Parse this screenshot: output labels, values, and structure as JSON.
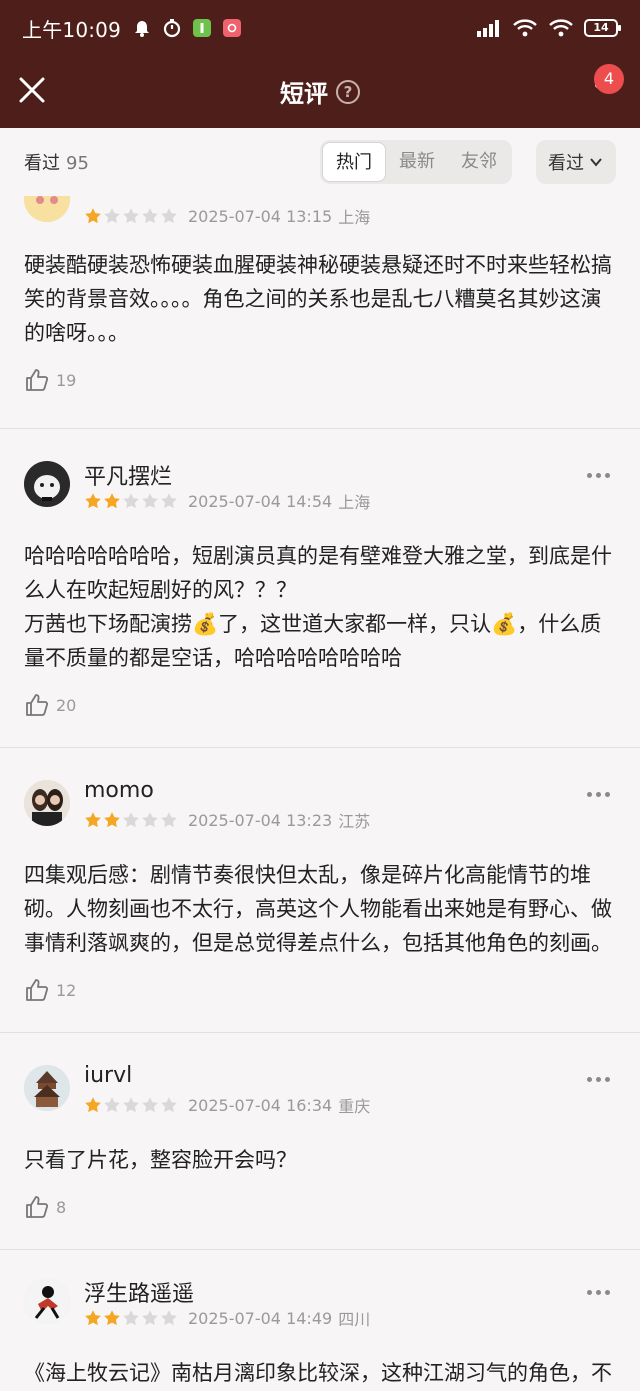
{
  "status_bar": {
    "time": "上午10:09",
    "battery": "14"
  },
  "header": {
    "title": "短评",
    "help": "?",
    "badge": "4"
  },
  "filter": {
    "seen_label": "看过",
    "seen_count": "95",
    "tabs": [
      "热门",
      "最新",
      "友邻"
    ],
    "dropdown": "看过"
  },
  "colors": {
    "header_bg": "#4e1f1a",
    "star_on": "#f5a623",
    "star_off": "#d9d9d9",
    "badge": "#ee4d4d"
  },
  "reviews": [
    {
      "user": "",
      "rating": 1,
      "date": "2025-07-04 13:15",
      "location": "上海",
      "text": "硬装酷硬装恐怖硬装血腥硬装神秘硬装悬疑还时不时来些轻松搞笑的背景音效。。。。角色之间的关系也是乱七八糟莫名其妙这演的啥呀。。。",
      "likes": "19"
    },
    {
      "user": "平凡摆烂",
      "rating": 2,
      "date": "2025-07-04 14:54",
      "location": "上海",
      "text": "哈哈哈哈哈哈哈，短剧演员真的是有壁难登大雅之堂，到底是什么人在吹起短剧好的风？？？\n万茜也下场配演捞💰了，这世道大家都一样，只认💰，什么质量不质量的都是空话，哈哈哈哈哈哈哈哈",
      "likes": "20"
    },
    {
      "user": "momo",
      "rating": 2,
      "date": "2025-07-04 13:23",
      "location": "江苏",
      "text": "四集观后感：剧情节奏很快但太乱，像是碎片化高能情节的堆砌。人物刻画也不太行，高英这个人物能看出来她是有野心、做事情利落飒爽的，但是总觉得差点什么，包括其他角色的刻画。",
      "likes": "12"
    },
    {
      "user": "iurvl",
      "rating": 1,
      "date": "2025-07-04 16:34",
      "location": "重庆",
      "text": "只看了片花，整容脸开会吗？",
      "likes": "8"
    },
    {
      "user": "浮生路遥遥",
      "rating": 2,
      "date": "2025-07-04 14:49",
      "location": "四川",
      "text": "《海上牧云记》南枯月漓印象比较深，这种江湖习气的角色，不知道演员有没有突破，看一集吧。……这是什么东西😂？短剧吗？碎片化、PPT化，表演、服化道都差强人",
      "likes": ""
    }
  ]
}
